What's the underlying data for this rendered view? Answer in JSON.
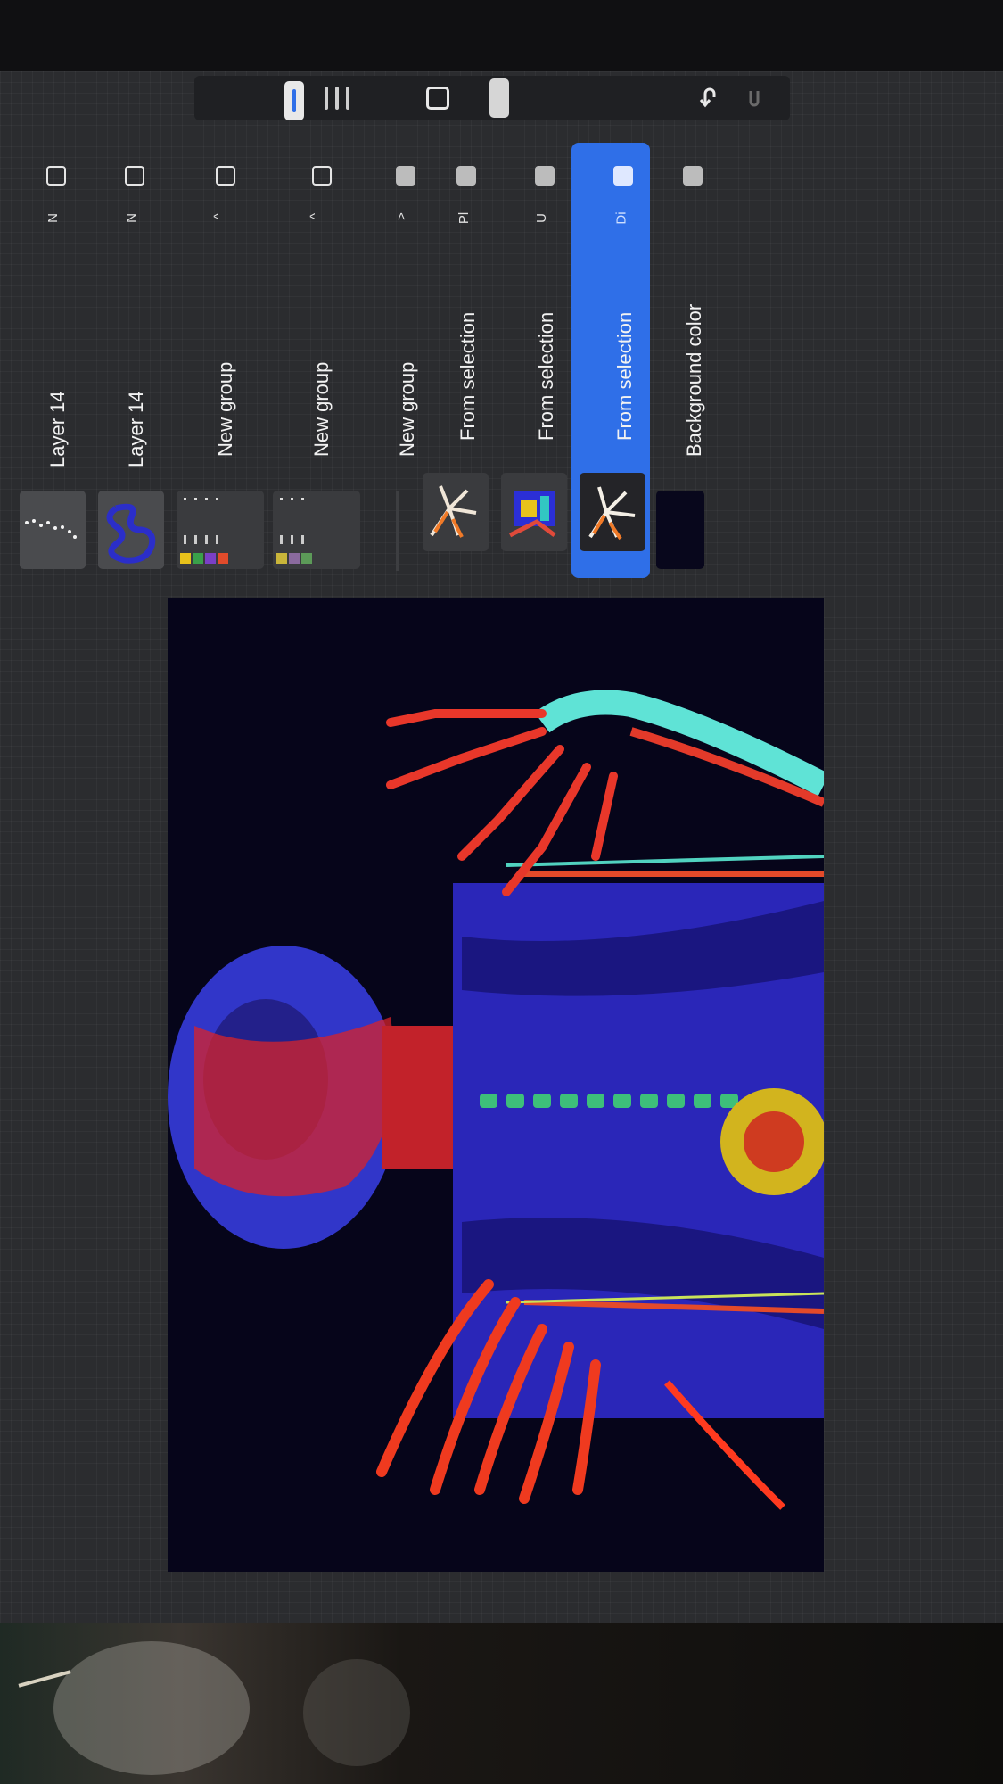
{
  "toolbar": {
    "brush_size_icon": "brush-size-slider",
    "opacity_icon": "opacity-slider",
    "modify_icon": "square-modify",
    "undo_icon": "undo-arrow",
    "redo_icon": "redo-arrow"
  },
  "layers": [
    {
      "name": "Layer 14",
      "mode": "N",
      "visible": true,
      "thumb": "dots"
    },
    {
      "name": "Layer 14",
      "mode": "N",
      "visible": true,
      "thumb": "blue-loops"
    },
    {
      "name": "New group",
      "mode": "^",
      "visible": true,
      "thumb": "group-colors"
    },
    {
      "name": "New group",
      "mode": "^",
      "visible": true,
      "thumb": "group-colors-2"
    },
    {
      "name": "New group",
      "mode": ">",
      "visible": false,
      "thumb": "empty"
    },
    {
      "name": "From selection",
      "mode": "Pl",
      "visible": false,
      "thumb": "hand-orange"
    },
    {
      "name": "From selection",
      "mode": "U",
      "visible": false,
      "thumb": "hand-blue"
    },
    {
      "name": "From selection",
      "mode": "Di",
      "visible": false,
      "thumb": "hand-orange-2",
      "selected": true
    },
    {
      "name": "Background color",
      "mode": "",
      "visible": false,
      "thumb": "dark"
    }
  ],
  "colors": {
    "accent": "#2f6fe8",
    "panel": "#2b2c2f",
    "canvas_bg": "#06051a"
  }
}
